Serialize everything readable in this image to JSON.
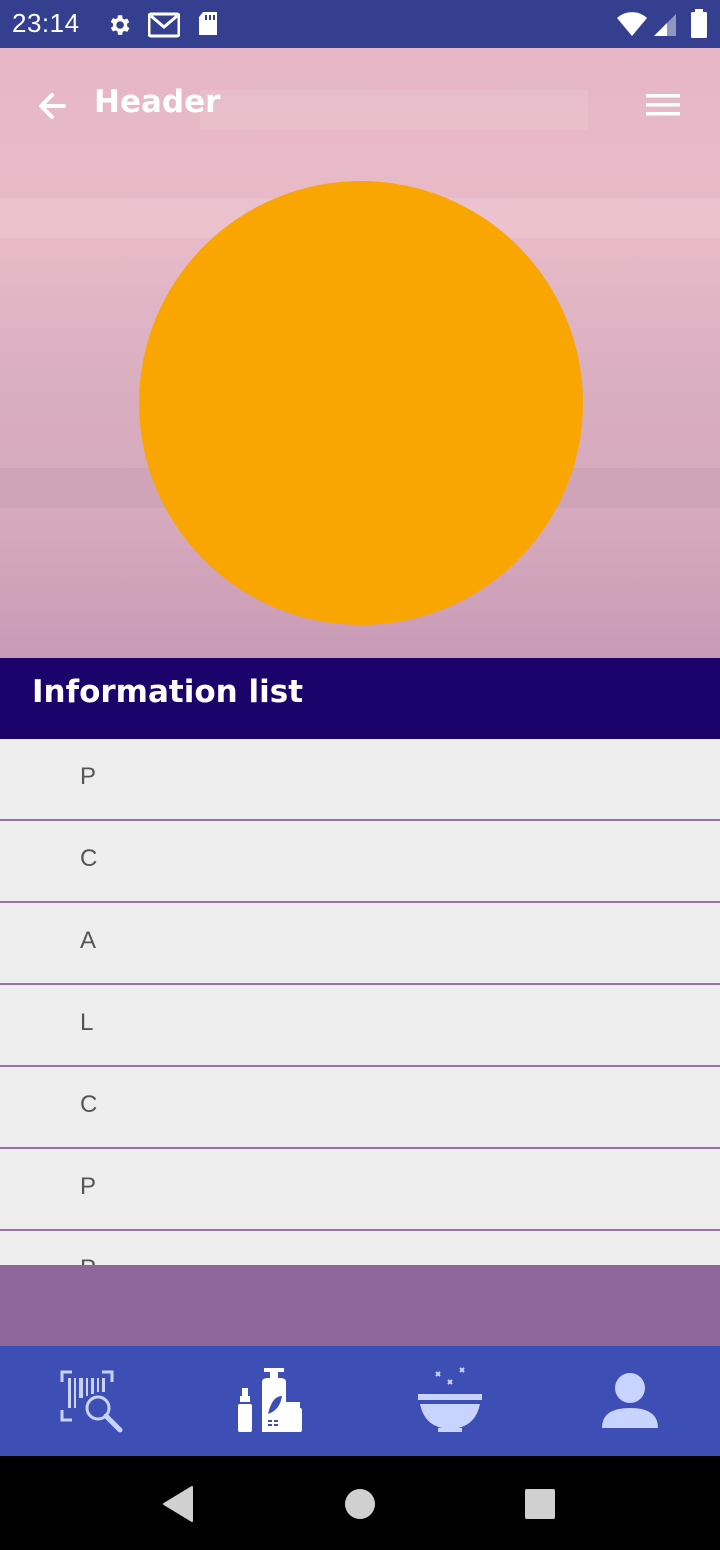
{
  "status_bar": {
    "time": "23:14",
    "icons": [
      "gear-icon",
      "gmail-icon",
      "sd-card-icon",
      "wifi-icon",
      "signal-icon",
      "battery-icon"
    ]
  },
  "header": {
    "title": "Header",
    "back_icon": "arrow-back-icon",
    "menu_icon": "hamburger-menu-icon"
  },
  "hero": {
    "circle_color": "#f9a603"
  },
  "section": {
    "title": "Information list"
  },
  "list": {
    "items": [
      {
        "label": "P"
      },
      {
        "label": "C"
      },
      {
        "label": "A"
      },
      {
        "label": "L"
      },
      {
        "label": "C"
      },
      {
        "label": "P"
      },
      {
        "label": "P"
      }
    ]
  },
  "bottom_nav": {
    "items": [
      {
        "icon": "barcode-search-icon"
      },
      {
        "icon": "cosmetics-bottles-icon"
      },
      {
        "icon": "bowl-icon"
      },
      {
        "icon": "user-icon"
      }
    ]
  },
  "system_nav": {
    "items": [
      "back-triangle-icon",
      "home-circle-icon",
      "recents-square-icon"
    ]
  },
  "colors": {
    "status_bar": "#34408f",
    "section_bar": "#1c036c",
    "list_divider": "#9b6fa7",
    "purple_band": "#8e6699",
    "bottom_nav": "#3d4fb5",
    "nav_icon": "#c9d3ff"
  }
}
